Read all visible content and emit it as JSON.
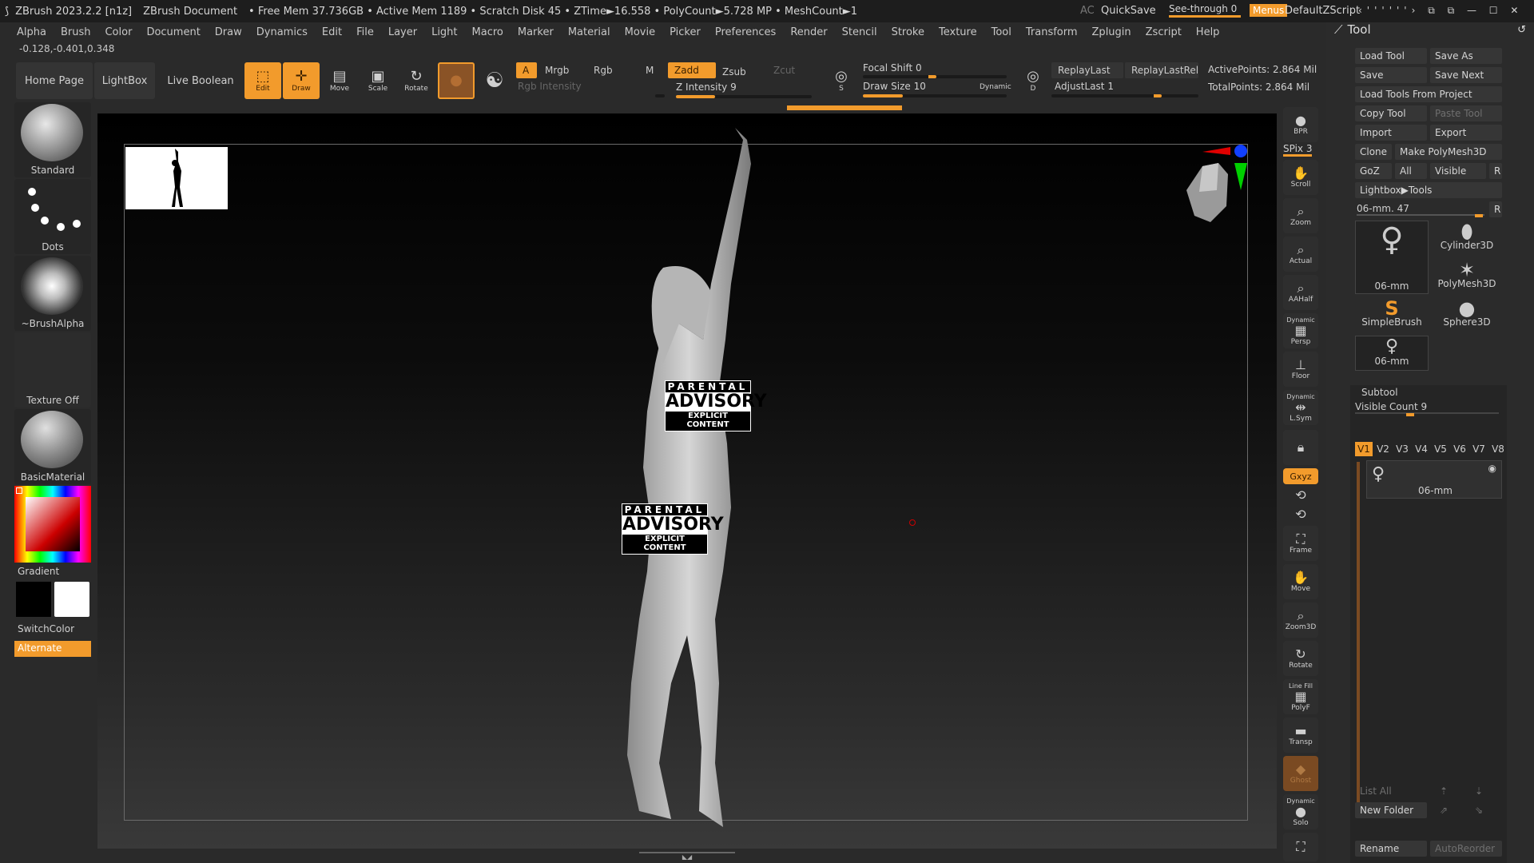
{
  "titlebar": {
    "app": "ZBrush 2023.2.2 [n1z]",
    "document": "ZBrush Document",
    "stats": "• Free Mem 37.736GB • Active Mem 1189 • Scratch Disk 45 • ZTime►16.558 • PolyCount►5.728 MP • MeshCount►1",
    "ac": "AC",
    "quicksave": "QuickSave",
    "seethrough": "See-through  0",
    "menus": "Menus",
    "script": "DefaultZScript"
  },
  "menubar": [
    "Alpha",
    "Brush",
    "Color",
    "Document",
    "Draw",
    "Dynamics",
    "Edit",
    "File",
    "Layer",
    "Light",
    "Macro",
    "Marker",
    "Material",
    "Movie",
    "Picker",
    "Preferences",
    "Render",
    "Stencil",
    "Stroke",
    "Texture",
    "Tool",
    "Transform",
    "Zplugin",
    "Zscript",
    "Help"
  ],
  "coords": "-0.128,-0.401,0.348",
  "toolbar": {
    "home": "Home Page",
    "lightbox": "LightBox",
    "liveboolean": "Live Boolean",
    "edit": "Edit",
    "draw": "Draw",
    "move": "Move",
    "scale": "Scale",
    "rotate": "Rotate",
    "a": "A",
    "mrgb": "Mrgb",
    "rgb": "Rgb",
    "m": "M",
    "zadd": "Zadd",
    "zsub": "Zsub",
    "zcut": "Zcut",
    "rgbint": "Rgb Intensity",
    "zint": "Z Intensity 9",
    "zint_value": 9,
    "focal": "Focal Shift 0",
    "drawsize": "Draw Size 10",
    "drawsize_value": 10,
    "dynamic": "Dynamic",
    "replaylast": "ReplayLast",
    "replaylastrel": "ReplayLastRel",
    "adjustlast": "AdjustLast 1",
    "activepoints": "ActivePoints: 2.864 Mil",
    "totalpoints": "TotalPoints: 2.864 Mil",
    "s": "S",
    "d": "D"
  },
  "left": {
    "standard": "Standard",
    "dots": "Dots",
    "brushalpha": "~BrushAlpha",
    "textureoff": "Texture Off",
    "basicmaterial": "BasicMaterial",
    "gradient": "Gradient",
    "switchcolor": "SwitchColor",
    "alternate": "Alternate"
  },
  "canvas": {
    "advisory1": "PARENTAL",
    "advisory2": "ADVISORY",
    "advisory3": "EXPLICIT CONTENT"
  },
  "rshelf": {
    "bpr": "BPR",
    "spix": "SPix 3",
    "scroll": "Scroll",
    "zoom": "Zoom",
    "actual": "Actual",
    "aahalf": "AAHalf",
    "persp": "Persp",
    "floor": "Floor",
    "lsym": "L.Sym",
    "xyz": "Gxyz",
    "frame": "Frame",
    "move": "Move",
    "zoom3d": "Zoom3D",
    "rotate": "Rotate",
    "polyf": "PolyF",
    "linefill": "Line Fill",
    "transp": "Transp",
    "ghost": "Ghost",
    "solo": "Solo",
    "dynamic": "Dynamic"
  },
  "tool": {
    "title": "Tool",
    "loadtool": "Load Tool",
    "saveas": "Save As",
    "save": "Save",
    "savenext": "Save Next",
    "loadfromproject": "Load Tools From Project",
    "copytool": "Copy Tool",
    "pastetool": "Paste Tool",
    "import": "Import",
    "export": "Export",
    "clone": "Clone",
    "makepolymesh": "Make PolyMesh3D",
    "goz": "GoZ",
    "all": "All",
    "visible": "Visible",
    "r": "R",
    "lightboxtools": "Lightbox▶Tools",
    "current": "06-mm. 47",
    "thumbs": [
      "06-mm",
      "Cylinder3D",
      "PolyMesh3D",
      "SimpleBrush",
      "Sphere3D",
      "06-mm"
    ],
    "subtool": "Subtool",
    "visiblecount": "Visible Count 9",
    "vtabs": [
      "V1",
      "V2",
      "V3",
      "V4",
      "V5",
      "V6",
      "V7",
      "V8"
    ],
    "subtoolname": "06-mm",
    "listall": "List All",
    "newfolder": "New Folder",
    "rename": "Rename",
    "autoreorder": "AutoReorder"
  }
}
